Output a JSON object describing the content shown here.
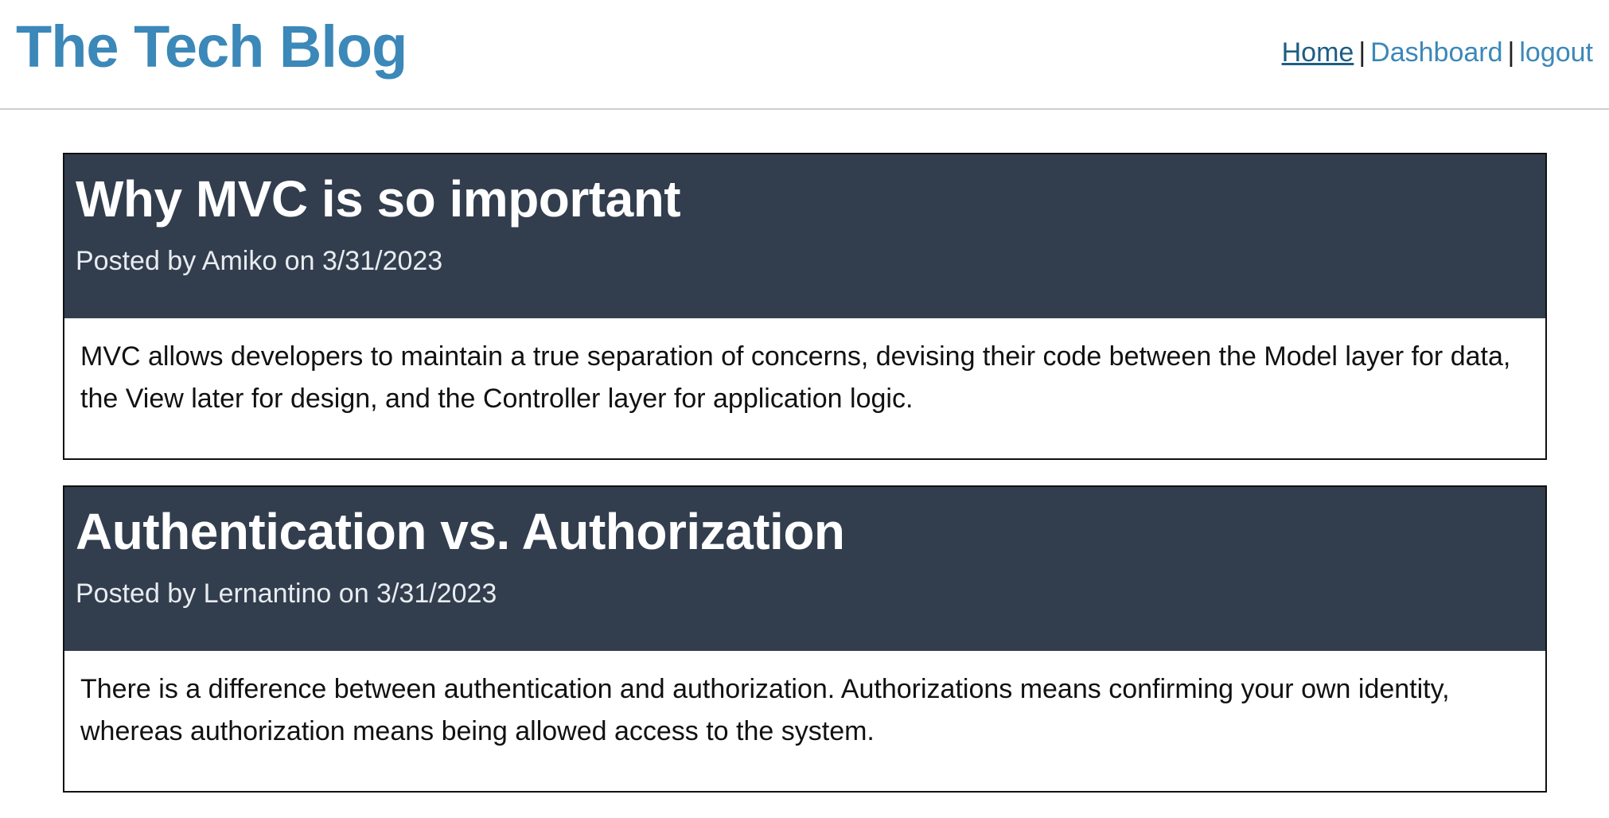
{
  "header": {
    "title": "The Tech Blog",
    "nav": {
      "home": "Home",
      "separator": "|",
      "dashboard": "Dashboard",
      "logout": "logout"
    }
  },
  "posts": [
    {
      "title": "Why MVC is so important",
      "meta": "Posted by Amiko on 3/31/2023",
      "body": "MVC allows developers to maintain a true separation of concerns, devising their code between the Model layer for data, the View later for design, and the Controller layer for application logic."
    },
    {
      "title": "Authentication vs. Authorization",
      "meta": "Posted by Lernantino on 3/31/2023",
      "body": "There is a difference between authentication and authorization. Authorizations means confirming your own identity, whereas authorization means being allowed access to the system."
    }
  ],
  "colors": {
    "brand": "#3b88b9",
    "post_header_bg": "#323e4e"
  }
}
